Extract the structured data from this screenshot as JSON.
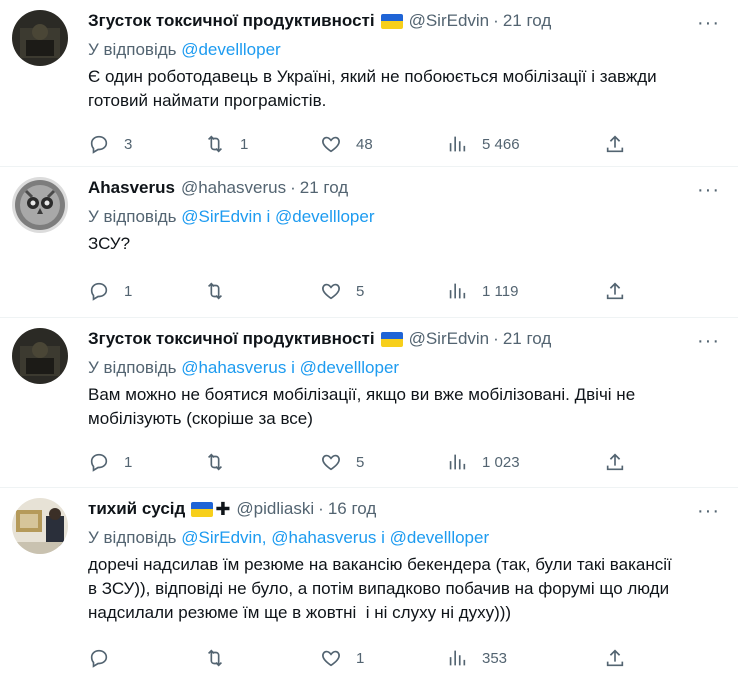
{
  "tweets": [
    {
      "name": "Згусток токсичної продуктивності",
      "handle": "@SirEdvin",
      "time": "21 год",
      "reply_prefix": "У відповідь ",
      "mentions": [
        "@devellloper"
      ],
      "text": "Є один роботодавець в Україні, який не побоюється мобілізації і завжди\nготовий наймати програмістів.",
      "replies": "3",
      "retweets": "1",
      "likes": "48",
      "views": "5 466"
    },
    {
      "name": "Ahasverus",
      "handle": "@hahasverus",
      "time": "21 год",
      "reply_prefix": "У відповідь ",
      "mentions": [
        "@SirEdvin",
        "@devellloper"
      ],
      "text": "ЗСУ?",
      "replies": "1",
      "retweets": "",
      "likes": "5",
      "views": "1 119"
    },
    {
      "name": "Згусток токсичної продуктивності",
      "handle": "@SirEdvin",
      "time": "21 год",
      "reply_prefix": "У відповідь ",
      "mentions": [
        "@hahasverus",
        "@devellloper"
      ],
      "text": "Вам можно не боятися мобілізації, якщо ви вже мобілізовані. Двічі не\nмобілізують (скоріше за все)",
      "replies": "1",
      "retweets": "",
      "likes": "5",
      "views": "1 023"
    },
    {
      "name": "тихий сусід",
      "handle": "@pidliaski",
      "time": "16 год",
      "reply_prefix": "У відповідь ",
      "mentions": [
        "@SirEdvin,",
        "@hahasverus",
        "@devellloper"
      ],
      "text": "доречі надсилав їм резюме на вакансію бекендера (так, були такі вакансії\nв ЗСУ)), відповіді не було, а потім випадково побачив на форумі що люди\nнадсилали резюме їм ще в жовтні  і ні слуху ні духу)))",
      "replies": "",
      "retweets": "",
      "likes": "1",
      "views": "353"
    }
  ],
  "separators": {
    "dot": "·",
    "and": " і ",
    "more": "···",
    "cross": "✚"
  },
  "colors": {
    "link": "#1d9bf0",
    "muted": "#536471",
    "text": "#0f1419",
    "flag_blue": "#1f64d6",
    "flag_yellow": "#f7cf1b"
  },
  "icons": {
    "reply": "reply-icon",
    "retweet": "retweet-icon",
    "like": "heart-icon",
    "views": "views-icon",
    "share": "share-icon",
    "more": "more-icon"
  }
}
